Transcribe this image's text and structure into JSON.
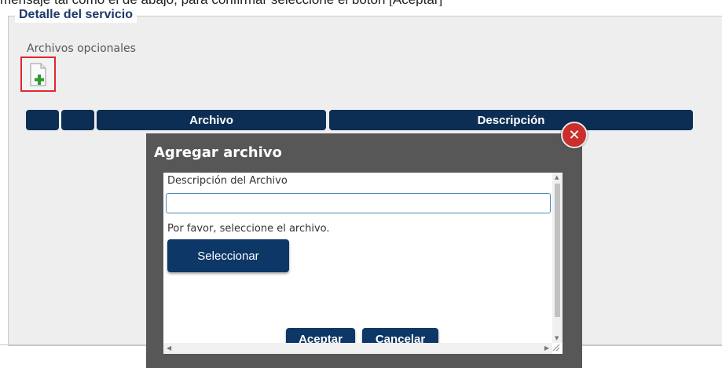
{
  "page": {
    "top_text": "mensaje tal como el de abajo, para confirmar seleccione el botón [Aceptar]",
    "section_legend": "Detalle del servicio",
    "optional_files_label": "Archivos opcionales"
  },
  "table": {
    "columns": [
      "",
      "",
      "Archivo",
      "Descripción"
    ]
  },
  "modal": {
    "title": "Agregar archivo",
    "close_symbol": "✕",
    "description_label": "Descripción del Archivo",
    "description_value": "",
    "select_prompt": "Por favor, seleccione el archivo.",
    "select_button": "Seleccionar",
    "accept_button": "Aceptar",
    "cancel_button": "Cancelar"
  },
  "icons": {
    "add_file": "add-file-icon",
    "close": "close-icon"
  },
  "colors": {
    "primary": "#0c2e55",
    "legend_text": "#1d3a6b",
    "close": "#c9302c",
    "highlight": "#e0282f",
    "modal_bg": "#575757"
  }
}
